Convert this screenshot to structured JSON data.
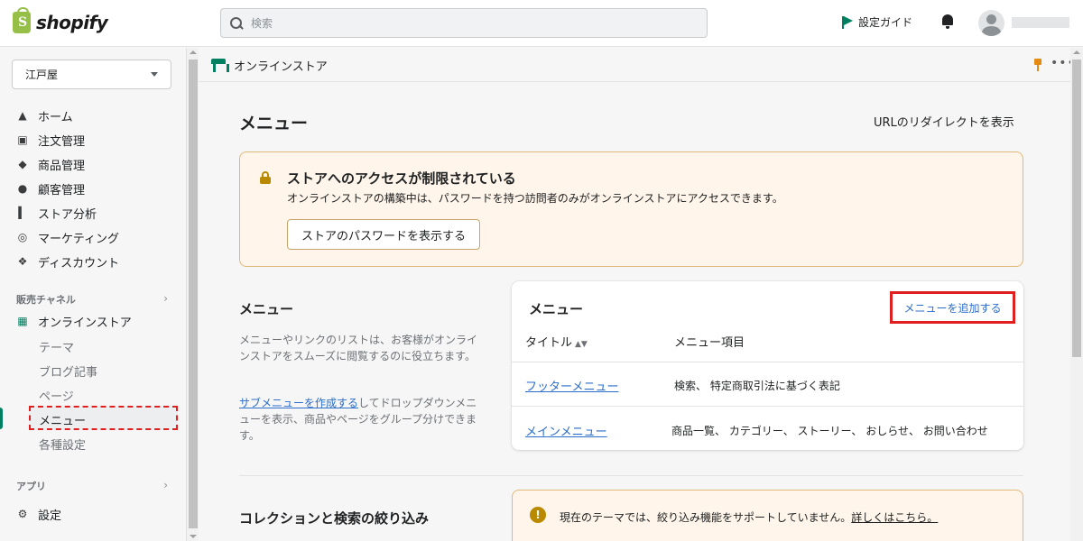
{
  "topbar": {
    "logo_text": "shopify",
    "search_placeholder": "検索",
    "setup_guide": "設定ガイド"
  },
  "sidebar": {
    "store_name": "江戸屋",
    "items": [
      {
        "label": "ホーム",
        "icon": "home-icon"
      },
      {
        "label": "注文管理",
        "icon": "inbox-icon"
      },
      {
        "label": "商品管理",
        "icon": "tag-icon"
      },
      {
        "label": "顧客管理",
        "icon": "person-icon"
      },
      {
        "label": "ストア分析",
        "icon": "bar-chart-icon"
      },
      {
        "label": "マーケティング",
        "icon": "target-icon"
      },
      {
        "label": "ディスカウント",
        "icon": "discount-icon"
      }
    ],
    "sales_channels_label": "販売チャネル",
    "online_store_label": "オンラインストア",
    "sub_items": [
      "テーマ",
      "ブログ記事",
      "ページ",
      "メニュー",
      "各種設定"
    ],
    "apps_label": "アプリ",
    "settings_label": "設定"
  },
  "header": {
    "app_title": "オンラインストア",
    "more": "•••"
  },
  "main": {
    "page_title": "メニュー",
    "redirect_link": "URLのリダイレクトを表示",
    "banner": {
      "title": "ストアへのアクセスが制限されている",
      "body": "オンラインストアの構築中は、パスワードを持つ訪問者のみがオンラインストアにアクセスできます。",
      "button": "ストアのパスワードを表示する"
    },
    "menu_section": {
      "heading": "メニュー",
      "desc": "メニューやリンクのリストは、お客様がオンラインストアをスムーズに閲覧するのに役立ちます。",
      "submenu_link": "サブメニューを作成する",
      "submenu_rest": "してドロップダウンメニューを表示、商品やページをグループ分けできます。"
    },
    "card": {
      "title": "メニュー",
      "add_button": "メニューを追加する",
      "col_title": "タイトル",
      "col_items": "メニュー項目",
      "rows": [
        {
          "title": "フッターメニュー",
          "items": "検索、 特定商取引法に基づく表記"
        },
        {
          "title": "メインメニュー",
          "items": "商品一覧、 カテゴリー、 ストーリー、 おしらせ、 お問い合わせ"
        }
      ]
    },
    "collection_section": {
      "heading": "コレクションと検索の絞り込み",
      "warning": "現在のテーマでは、絞り込み機能をサポートしていません。",
      "warning_link": "詳しくはこちら。"
    }
  },
  "colors": {
    "accent_green": "#008060",
    "link_blue": "#2c6ecb",
    "highlight_red": "#e02020",
    "warning_bg": "#fff5ea"
  }
}
